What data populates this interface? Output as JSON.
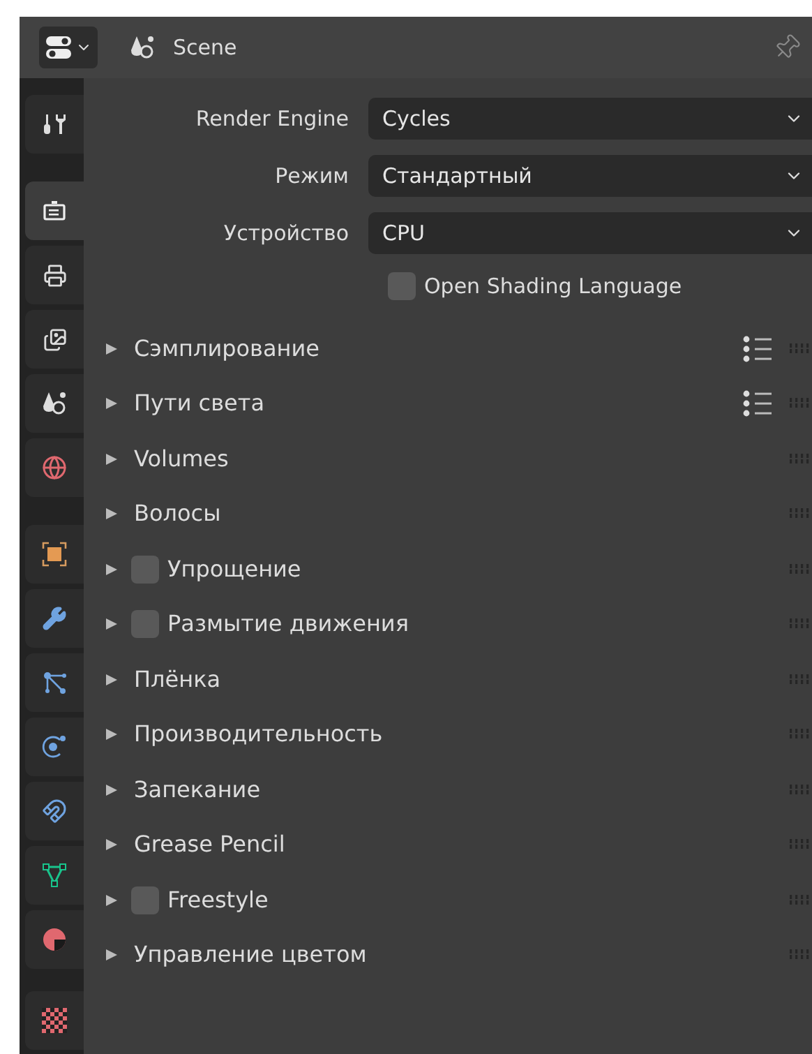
{
  "header": {
    "title": "Scene"
  },
  "sidebar": {
    "groups": [
      [
        {
          "selected": false
        }
      ],
      [
        {
          "selected": true
        },
        {
          "selected": false
        },
        {
          "selected": false
        },
        {
          "selected": false
        },
        {
          "selected": false
        }
      ],
      [
        {
          "selected": false
        },
        {
          "selected": false
        },
        {
          "selected": false
        },
        {
          "selected": false
        },
        {
          "selected": false
        },
        {
          "selected": false
        },
        {
          "selected": false
        }
      ],
      [
        {
          "selected": false
        }
      ]
    ]
  },
  "fields": [
    {
      "label": "Render Engine",
      "value": "Cycles"
    },
    {
      "label": "Режим",
      "value": "Стандартный"
    },
    {
      "label": "Устройство",
      "value": "CPU"
    }
  ],
  "osl": {
    "label": "Open Shading Language",
    "checked": false
  },
  "sections": [
    {
      "label": "Сэмплирование",
      "expanded": false,
      "presets": true
    },
    {
      "label": "Пути света",
      "expanded": false,
      "presets": true
    },
    {
      "label": "Volumes",
      "expanded": false,
      "presets": false
    },
    {
      "label": "Волосы",
      "expanded": false,
      "presets": false
    },
    {
      "label": "Упрощение",
      "expanded": false,
      "presets": false,
      "checked": false
    },
    {
      "label": "Размытие движения",
      "expanded": false,
      "presets": false,
      "checked": false
    },
    {
      "label": "Плёнка",
      "expanded": false,
      "presets": false
    },
    {
      "label": "Производительность",
      "expanded": false,
      "presets": false
    },
    {
      "label": "Запекание",
      "expanded": false,
      "presets": false
    },
    {
      "label": "Grease Pencil",
      "expanded": false,
      "presets": false
    },
    {
      "label": "Freestyle",
      "expanded": false,
      "presets": false,
      "checked": false
    },
    {
      "label": "Управление цветом",
      "expanded": false,
      "presets": false
    }
  ]
}
